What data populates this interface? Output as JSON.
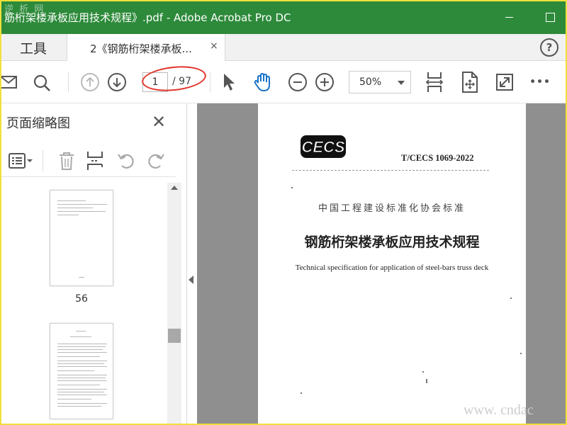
{
  "window": {
    "title": "筋桁架楼承板应用技术规程》.pdf - Adobe Acrobat Pro DC",
    "watermark": "逆 析 网"
  },
  "tabs": {
    "tools_label": "工具",
    "doc_label": "2《钢筋桁架楼承板...",
    "close_glyph": "×",
    "help_glyph": "?"
  },
  "toolbar": {
    "page_current": "1",
    "page_total": "/ 97",
    "zoom": "50%",
    "more_glyph": "•••"
  },
  "panel": {
    "title": "页面缩略图",
    "close_glyph": "✕",
    "thumbnails": [
      {
        "label": "56"
      },
      {
        "label": ""
      }
    ]
  },
  "document": {
    "logo_text": "CECS",
    "standard_no": "T/CECS 1069-2022",
    "subtitle_cn": "中国工程建设标准化协会标准",
    "title_cn": "钢筋桁架楼承板应用技术规程",
    "title_en": "Technical specification for application of steel-bars truss deck"
  },
  "site_watermark": "www. cndac",
  "colors": {
    "titlebar": "#2d8a3a",
    "annotation_oval": "#e0342a",
    "hand_tool": "#1a73c9",
    "frame": "#f0e03a"
  }
}
